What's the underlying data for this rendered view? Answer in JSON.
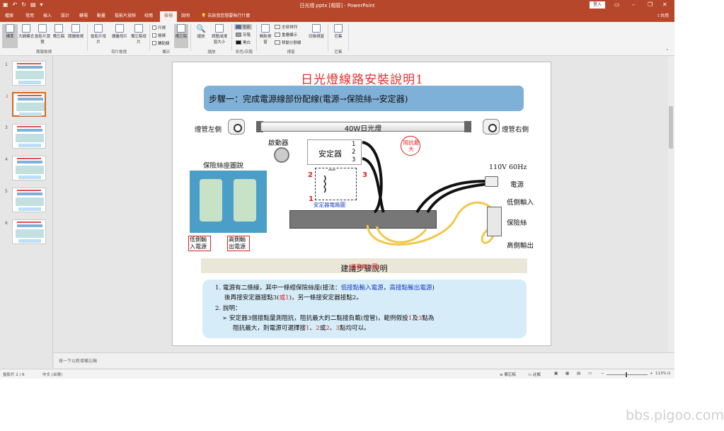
{
  "window": {
    "title": "日光燈.pptx [相容] - PowerPoint",
    "signin": "登入",
    "share": "共用",
    "tell_me": "告訴我您想要執行什麼"
  },
  "tabs": [
    "檔案",
    "常用",
    "插入",
    "設計",
    "轉場",
    "動畫",
    "投影片放映",
    "校閱",
    "檢視",
    "說明"
  ],
  "active_tab": "檢視",
  "ribbon": {
    "buttons": {
      "normal": "標準",
      "outline": "大綱模式",
      "sorter": "投影片瀏覽",
      "notes_page": "備忘稿",
      "reading": "閱讀檢視",
      "slide_master": "投影片母片",
      "handout_master": "講義母片",
      "notes_master": "備忘稿母片",
      "notes": "備忘稿",
      "zoom": "縮放",
      "fit": "調整成視窗大小",
      "new_window": "開新視窗",
      "switch_windows": "切換視窗",
      "macros": "巨集"
    },
    "checks": {
      "ruler": "尺規",
      "gridlines": "格線",
      "guides": "輔助線"
    },
    "color": {
      "color": "色彩",
      "grayscale": "灰階",
      "bw": "黑白"
    },
    "window_items": {
      "arrange_all": "全部排列",
      "cascade": "重疊顯示",
      "move_split": "移動分割線"
    },
    "groups": {
      "presentation_views": "簡報檢視",
      "master_views": "母片檢視",
      "show": "顯示",
      "zoom": "縮放",
      "color": "彩色/灰階",
      "window": "視窗",
      "macros": "巨集"
    }
  },
  "thumbnails": {
    "numbers": [
      "1",
      "2",
      "3",
      "4",
      "5",
      "6"
    ],
    "active": "2"
  },
  "slide": {
    "title": "日光燈線路安裝說明1",
    "step": "步驟一：完成電源線部份配線(電源→保險絲→安定器)",
    "left_socket": "燈管左側",
    "right_socket": "燈管右側",
    "tube": "40W日光燈",
    "starter": "啟動器",
    "ballast": "安定器",
    "ballast_terms": [
      "1",
      "2",
      "3"
    ],
    "callout": "阻抗最大",
    "circuit_nums": {
      "left": "2",
      "right": "3",
      "bottom": "1"
    },
    "circuit_label": "安定器電路圖",
    "photo_title": "保險絲座圖說",
    "fuse_low": "低側輸入電源",
    "fuse_high": "高側輸出電源",
    "voltage": "110V 60Hz",
    "power": "電源",
    "low_input": "低側輸入",
    "fuse": "保險絲",
    "high_output": "高側輸出",
    "suggest": "建議步驟說明",
    "suggest_sub": "(請參閱上圖)",
    "body": {
      "l1a": "1. 電源有二條線，其中一條經保險絲座(接法：",
      "l1b": "低接點輸入電源",
      "l1c": "，",
      "l1d": "高接點輸出電源",
      "l1e": ")",
      "l2a": "後再接安定器接點3(",
      "l2b": "或1",
      "l2c": ")，另一條接安定器接點2。",
      "l3": "2. 說明：",
      "l4a": "➢ 安定器3個接點量測阻抗，阻抗最大的二點接負載(燈管)，範例假設",
      "l4b": "1",
      "l4c": "及",
      "l4d": "3",
      "l4e": "點為",
      "l5a": "阻抗最大，則電源可選擇接",
      "l5b": "1",
      "l5c": "、",
      "l5d": "2",
      "l5e": "或",
      "l5f": "2",
      "l5g": "、",
      "l5h": "3",
      "l5i": "點均可以。"
    }
  },
  "notes_placeholder": "按一下以新增備忘稿",
  "status": {
    "slide_count": "投影片 2 / 6",
    "language": "中文 (台灣)",
    "notes": "備忘稿",
    "comments": "註解",
    "zoom": "113%"
  },
  "watermark": "bbs.pigoo.com",
  "colors": {
    "brand": "#b7472a",
    "accent_blue": "#7fb0d8",
    "red": "#e02020"
  }
}
